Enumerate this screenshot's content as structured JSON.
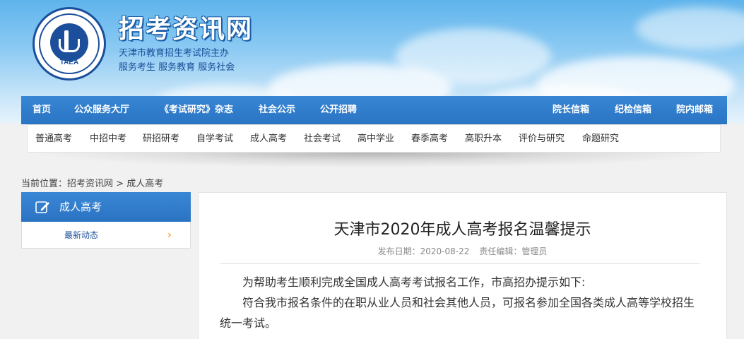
{
  "header": {
    "site_name": "招考资讯网",
    "logo_text": "TAEA",
    "subtitle_1": "天津市教育招生考试院主办",
    "subtitle_2": "服务考生 服务教育 服务社会"
  },
  "main_nav": {
    "left": [
      "首页",
      "公众服务大厅",
      "《考试研究》杂志",
      "社会公示",
      "公开招聘"
    ],
    "right": [
      "院长信箱",
      "纪检信箱",
      "院内邮箱"
    ]
  },
  "sub_nav": [
    "普通高考",
    "中招中考",
    "研招研考",
    "自学考试",
    "成人高考",
    "社会考试",
    "高中学业",
    "春季高考",
    "高职升本",
    "评价与研究",
    "命题研究"
  ],
  "breadcrumb": {
    "prefix": "当前位置：",
    "home": "招考资讯网",
    "sep": " > ",
    "current": "成人高考"
  },
  "sidebar": {
    "title": "成人高考",
    "icon": "edit-icon",
    "items": [
      {
        "label": "最新动态",
        "arrow": "›"
      }
    ]
  },
  "article": {
    "title": "天津市2020年成人高考报名温馨提示",
    "publish_label": "发布日期：",
    "publish_date": "2020-08-22",
    "editor_label": "责任编辑：",
    "editor": "管理员",
    "paragraphs": [
      "为帮助考生顺利完成全国成人高考考试报名工作，市高招办提示如下:",
      "符合我市报名条件的在职从业人员和社会其他人员，可报名参加全国各类成人高等学校招生统一考试。"
    ]
  },
  "colors": {
    "nav_blue": "#2a74c4",
    "title_blue": "#1a5ea8",
    "arrow_orange": "#f5a623"
  }
}
